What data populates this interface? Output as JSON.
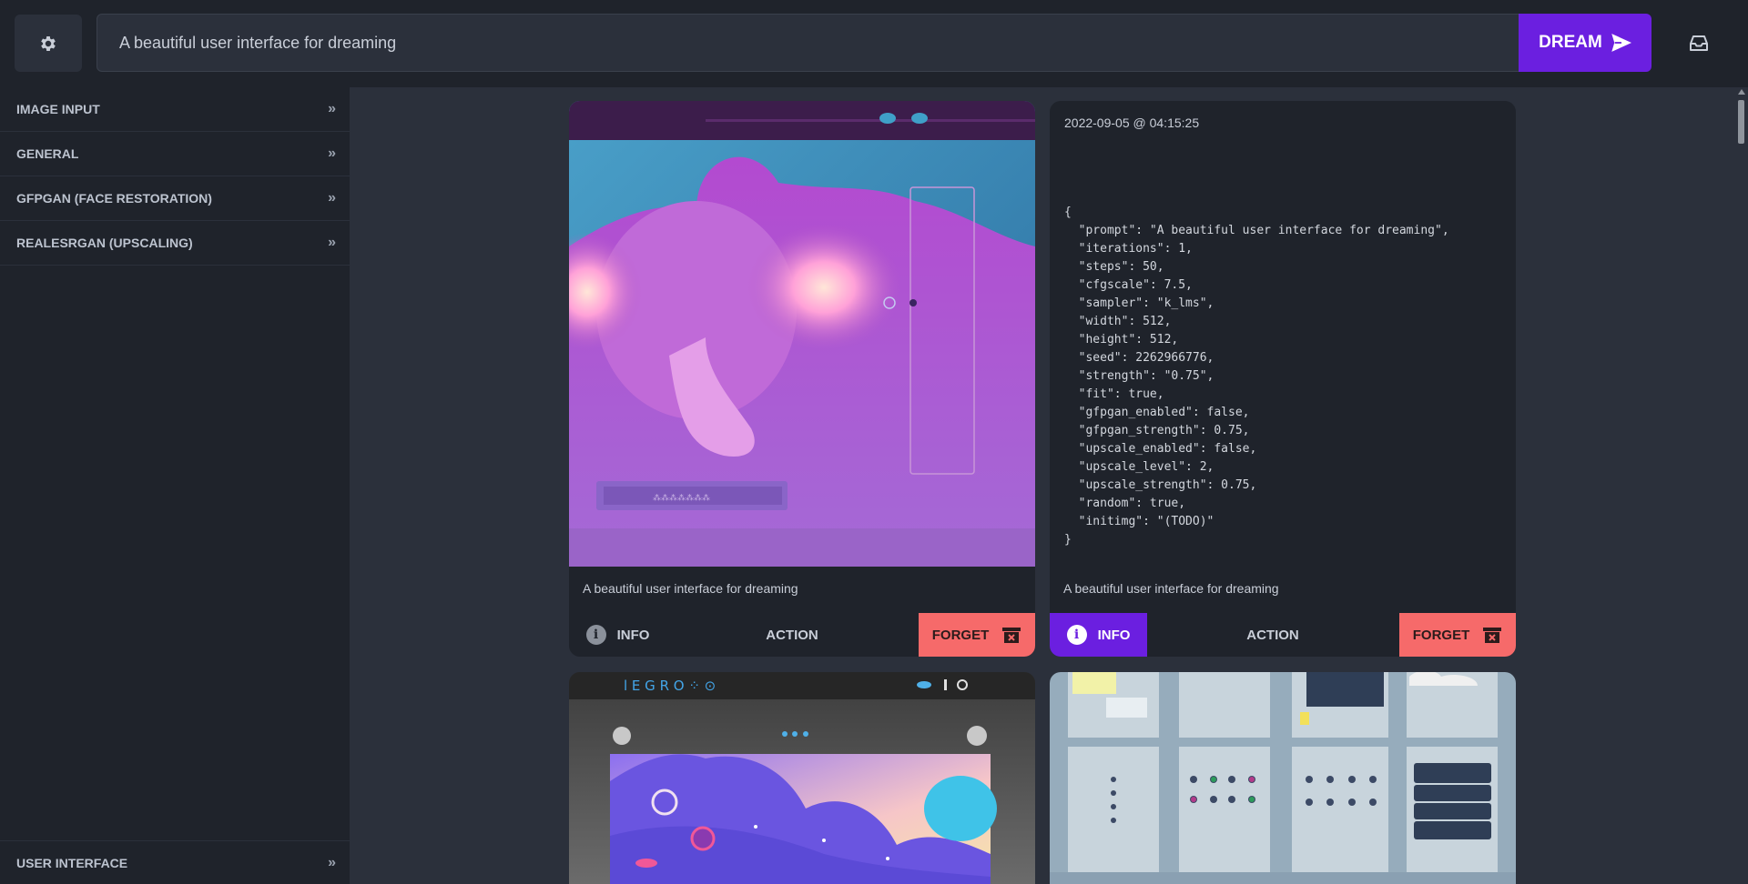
{
  "header": {
    "prompt_value": "A beautiful user interface for dreaming",
    "dream_label": "DREAM"
  },
  "sidebar": {
    "items": [
      {
        "label": "IMAGE INPUT"
      },
      {
        "label": "GENERAL"
      },
      {
        "label": "GFPGAN (FACE RESTORATION)"
      },
      {
        "label": "REALESRGAN (UPSCALING)"
      }
    ],
    "bottom_label": "USER INTERFACE"
  },
  "gallery": {
    "cards": [
      {
        "caption": "A beautiful user interface for dreaming",
        "info_label": "INFO",
        "action_label": "ACTION",
        "forget_label": "FORGET",
        "info_active": false
      },
      {
        "timestamp": "2022-09-05 @ 04:15:25",
        "metadata_json": "{\n  \"prompt\": \"A beautiful user interface for dreaming\",\n  \"iterations\": 1,\n  \"steps\": 50,\n  \"cfgscale\": 7.5,\n  \"sampler\": \"k_lms\",\n  \"width\": 512,\n  \"height\": 512,\n  \"seed\": 2262966776,\n  \"strength\": \"0.75\",\n  \"fit\": true,\n  \"gfpgan_enabled\": false,\n  \"gfpgan_strength\": 0.75,\n  \"upscale_enabled\": false,\n  \"upscale_level\": 2,\n  \"upscale_strength\": 0.75,\n  \"random\": true,\n  \"initimg\": \"(TODO)\"\n}",
        "caption": "A beautiful user interface for dreaming",
        "info_label": "INFO",
        "action_label": "ACTION",
        "forget_label": "FORGET",
        "info_active": true
      }
    ]
  },
  "colors": {
    "accent": "#6b1fe0",
    "forget": "#f66a6a",
    "panel": "#1f232b",
    "background": "#2b303b"
  },
  "icons": [
    "gear-icon",
    "send-icon",
    "inbox-icon",
    "chevrons-right-icon",
    "info-icon",
    "trash-icon"
  ]
}
